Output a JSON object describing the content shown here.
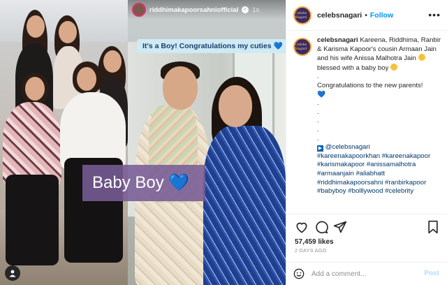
{
  "story": {
    "username": "riddhimakapoorsahniofficial",
    "time": "1s",
    "caption": "It's a Boy! Congratulations my cuties 💙"
  },
  "overlay": {
    "text": "Baby Boy 💙"
  },
  "header": {
    "username": "celebsnagari",
    "dot": "•",
    "follow_label": "Follow",
    "avatar_text": "Celebs Nagari"
  },
  "caption": {
    "username": "celebsnagari",
    "text_1": "Kareena, Riddhima, Ranbir & Karisma Kapoor's cousin Armaan Jain and his wife Anissa Malhotra Jain",
    "text_2": "blessed with a baby boy",
    "dot": ".",
    "congrats": "Congratulations to the new parents!",
    "mention": "@celebsnagari",
    "hashtags": [
      "#kareenakapoorkhan #kareenakapoor",
      "#karismakapoor #anissamalhotra",
      "#armaanjain #aliabhatt",
      "#riddhimakapoorsahni #ranbirkapoor",
      "#babyboy #bolllywood #celebrity"
    ]
  },
  "stats": {
    "likes": "57,459 likes",
    "ago": "2 DAYS AGO"
  },
  "comment": {
    "placeholder": "Add a comment...",
    "post_label": "Post"
  },
  "colors": {
    "link": "#0095f6",
    "hashtag": "#00376b",
    "overlay_bg": "#785c96",
    "story_caption_bg": "#cfeaf4"
  }
}
